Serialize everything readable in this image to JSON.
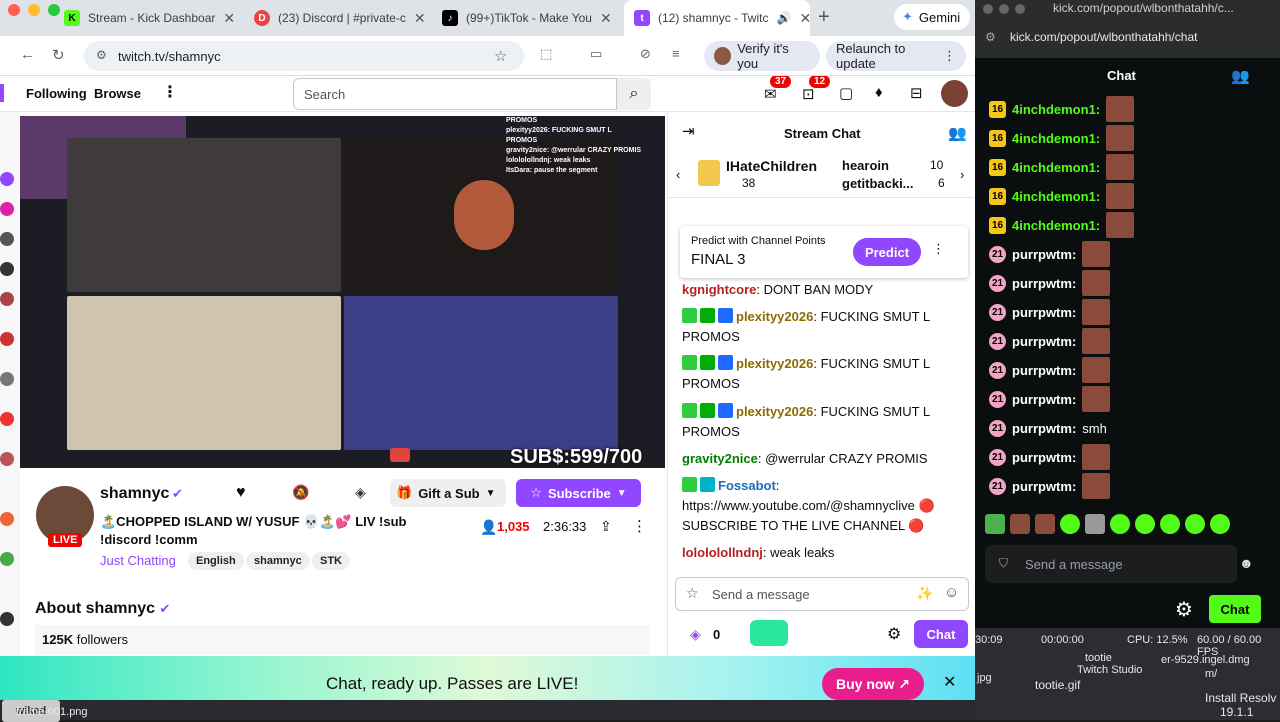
{
  "browser": {
    "tabs": [
      {
        "label": "Stream - Kick Dashboar",
        "icon": "kick-icon",
        "color": "#53fc18"
      },
      {
        "label": "(23) Discord | #private-c",
        "icon": "discord-icon",
        "color": "#ed4245"
      },
      {
        "label": "(99+)TikTok - Make You",
        "icon": "tiktok-icon",
        "color": "#000000"
      },
      {
        "label": "(12) shamnyc - Twitc",
        "icon": "twitch-icon",
        "color": "#9147ff"
      }
    ],
    "gemini_label": "Gemini",
    "url": "twitch.tv/shamnyc",
    "verify_label": "Verify it's you",
    "relaunch_label": "Relaunch to update"
  },
  "twitch_nav": {
    "following": "Following",
    "browse": "Browse",
    "search_placeholder": "Search",
    "notif_count": "37",
    "inbox_count": "12"
  },
  "stream": {
    "subs_overlay": "SUB$:599/700",
    "overlay_chat": [
      "PROMOS",
      "plexityy2026: FUCKING SMUT L",
      "PROMOS",
      "gravity2nice: @werrular CRAZY PROMIS",
      "lolololollndnj: weak leaks",
      "ItsDara: pause the segment"
    ]
  },
  "channel": {
    "name": "shamnyc",
    "live_label": "LIVE",
    "title": "🏝️CHOPPED ISLAND W/ YUSUF 💀🏝️💕 LIV !sub !discord !comm",
    "category": "Just Chatting",
    "tags": [
      "English",
      "shamnyc",
      "STK"
    ],
    "viewers": "1,035",
    "uptime": "2:36:33",
    "gift_label": "Gift a Sub",
    "subscribe_label": "Subscribe",
    "about_label": "About shamnyc",
    "followers": "125K",
    "followers_label": "followers"
  },
  "chat": {
    "header": "Stream Chat",
    "leaderboard": [
      {
        "name": "IHateChildren",
        "count": "38",
        "rank": "1"
      },
      {
        "name": "hearoin",
        "count": "10",
        "rank": "2"
      },
      {
        "name": "getitbacki...",
        "count": "6",
        "rank": "3"
      }
    ],
    "prediction": {
      "label": "Predict with Channel Points",
      "title": "FINAL 3",
      "button": "Predict"
    },
    "messages": [
      {
        "user": "kgnightcore",
        "color": "#b22222",
        "text": "DONT BAN MODY"
      },
      {
        "user": "plexityy2026",
        "color": "#8a6d00",
        "text": "FUCKING SMUT L PROMOS"
      },
      {
        "user": "plexityy2026",
        "color": "#8a6d00",
        "text": "FUCKING SMUT L PROMOS"
      },
      {
        "user": "plexityy2026",
        "color": "#8a6d00",
        "text": "FUCKING SMUT L PROMOS"
      },
      {
        "user": "gravity2nice",
        "color": "#008000",
        "text": "@werrular CRAZY PROMIS"
      },
      {
        "user": "Fossabot",
        "color": "#1e6bb8",
        "text": "https://www.youtube.com/@shamnyclive 🔴 SUBSCRIBE TO THE LIVE CHANNEL 🔴"
      },
      {
        "user": "lolololollndnj",
        "color": "#b22222",
        "text": "weak leaks"
      }
    ],
    "input_placeholder": "Send a message",
    "points": "0",
    "chat_button": "Chat"
  },
  "banner": {
    "text": "Chat, ready up. Passes are LIVE!",
    "button": "Buy now ↗"
  },
  "kick": {
    "url": "kick.com/popout/wlbonthatahh/chat",
    "window_title": "kick.com/popout/wlbonthatahh/c...",
    "header": "Chat",
    "messages": [
      {
        "badge": "16",
        "user": "4inchdemon1:",
        "color": "#53fc18",
        "text": ""
      },
      {
        "badge": "16",
        "user": "4inchdemon1:",
        "color": "#53fc18",
        "text": ""
      },
      {
        "badge": "16",
        "user": "4inchdemon1:",
        "color": "#53fc18",
        "text": ""
      },
      {
        "badge": "16",
        "user": "4inchdemon1:",
        "color": "#53fc18",
        "text": ""
      },
      {
        "badge": "16",
        "user": "4inchdemon1:",
        "color": "#53fc18",
        "text": ""
      },
      {
        "badge": "21",
        "user": "purrpwtm:",
        "color": "#ffffff",
        "text": ""
      },
      {
        "badge": "21",
        "user": "purrpwtm:",
        "color": "#ffffff",
        "text": ""
      },
      {
        "badge": "21",
        "user": "purrpwtm:",
        "color": "#ffffff",
        "text": ""
      },
      {
        "badge": "21",
        "user": "purrpwtm:",
        "color": "#ffffff",
        "text": ""
      },
      {
        "badge": "21",
        "user": "purrpwtm:",
        "color": "#ffffff",
        "text": ""
      },
      {
        "badge": "21",
        "user": "purrpwtm:",
        "color": "#ffffff",
        "text": ""
      },
      {
        "badge": "21",
        "user": "purrpwtm:",
        "color": "#ffffff",
        "text": "smh"
      },
      {
        "badge": "21",
        "user": "purrpwtm:",
        "color": "#ffffff",
        "text": ""
      },
      {
        "badge": "21",
        "user": "purrpwtm:",
        "color": "#ffffff",
        "text": ""
      }
    ],
    "input_placeholder": "Send a message",
    "chat_button": "Chat"
  },
  "desktop": {
    "time": "30:09",
    "timer": "00:00:00",
    "cpu": "CPU: 12.5%",
    "fps": "60.00 / 60.00 FPS",
    "files": [
      "tootie",
      "Twitch Studio",
      "er-9529.ingel.dmg",
      "jpg",
      "tootie.gif",
      "m/",
      "Install Resolv",
      "19.1.1",
      "frame-001.png"
    ]
  }
}
